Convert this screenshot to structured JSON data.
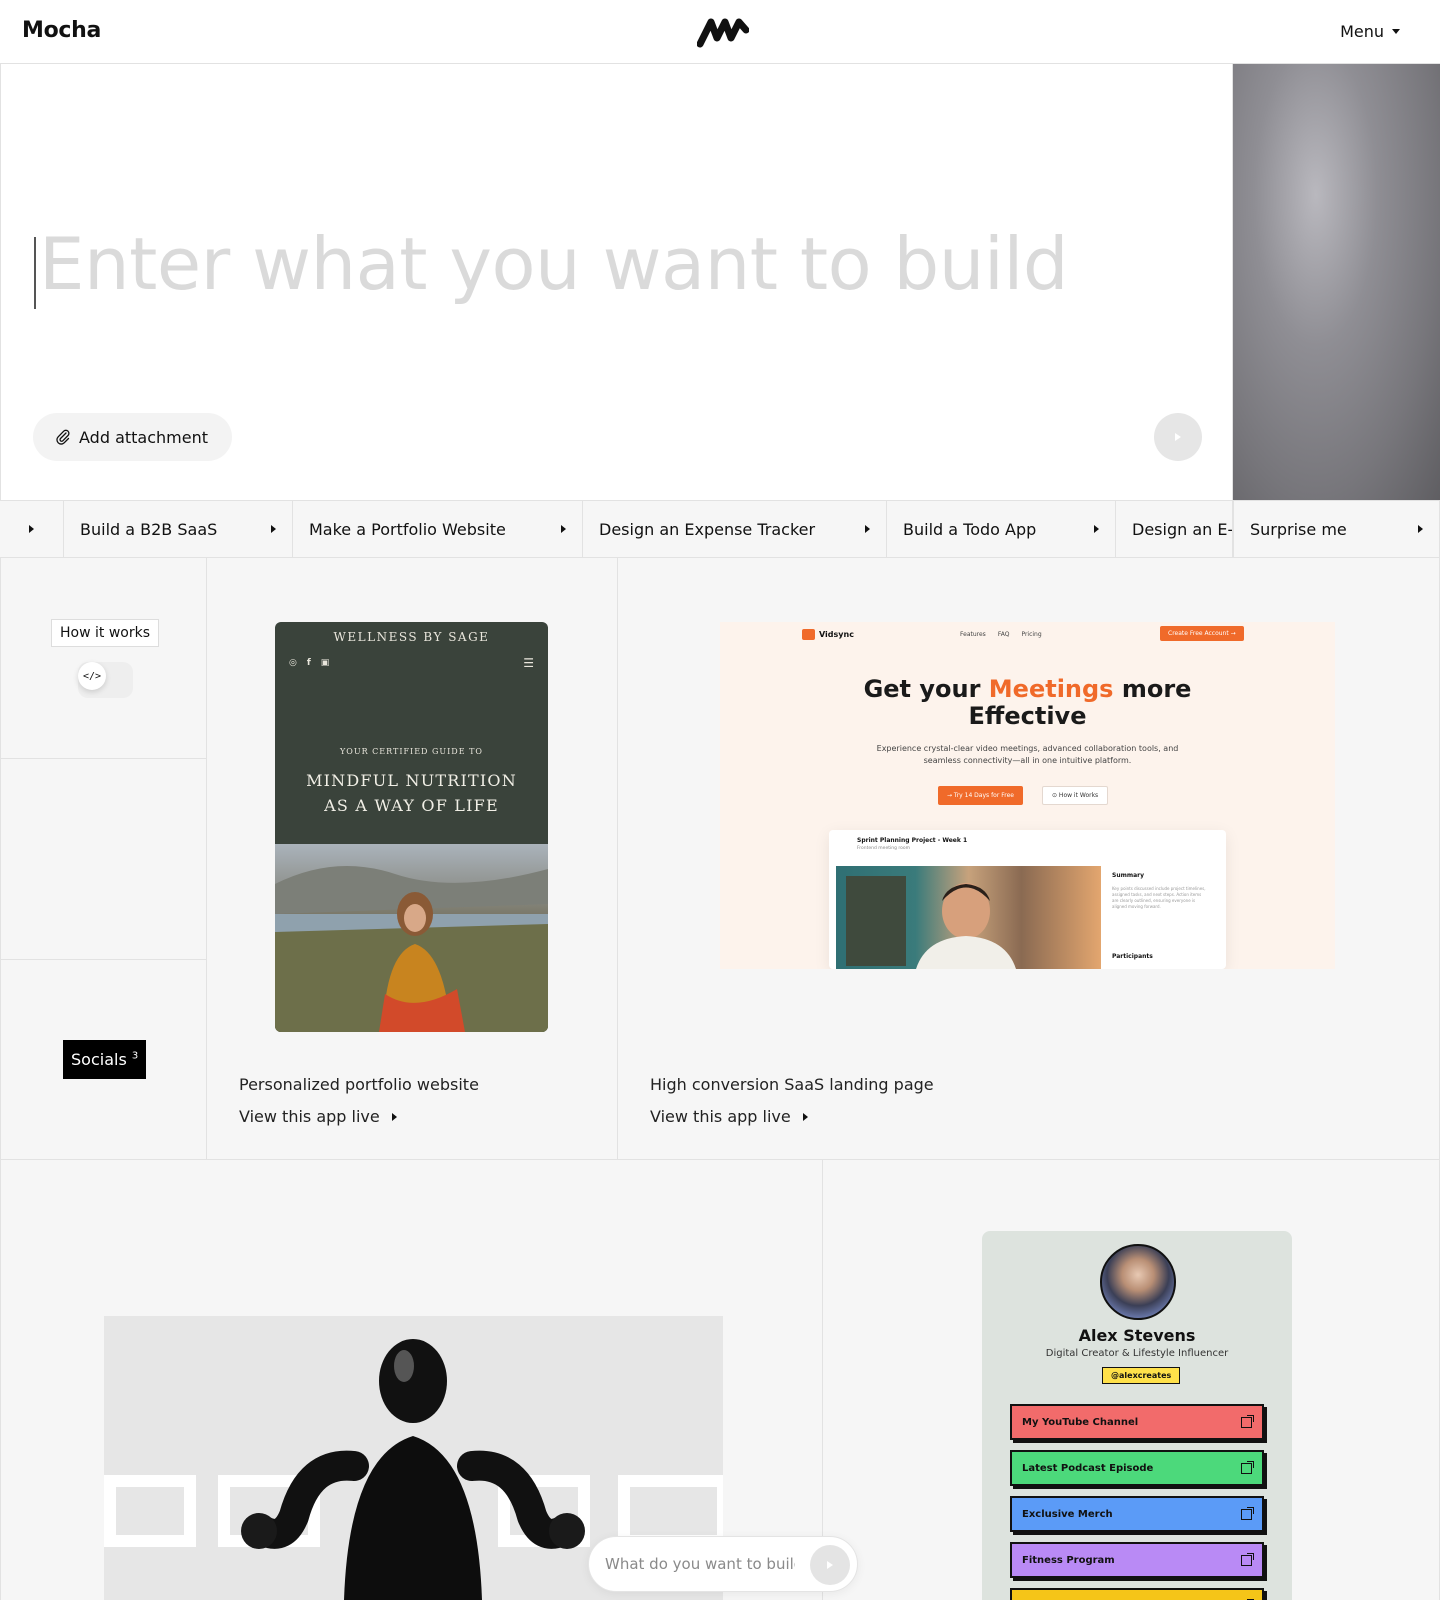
{
  "header": {
    "brand": "Mocha",
    "logo_icon": "mocha-wave-logo",
    "menu_label": "Menu"
  },
  "hero": {
    "prompt_placeholder": "Enter what you want to build",
    "attach_label": "Add attachment",
    "attach_icon": "paperclip-icon",
    "send_icon": "play-arrow-icon"
  },
  "suggestions": [
    "Build a B2B SaaS",
    "Make a Portfolio Website",
    "Design an Expense Tracker",
    "Build a Todo App",
    "Design an E-",
    "Surprise me"
  ],
  "sidebar": {
    "how_it_works": "How it works",
    "code_toggle": "</>",
    "socials_label": "Socials",
    "socials_count": "3"
  },
  "showcase": [
    {
      "caption": "Personalized portfolio website",
      "link": "View this app live",
      "preview": {
        "title": "WELLNESS BY SAGE",
        "subtitle": "YOUR CERTIFIED GUIDE TO",
        "headline_line1": "MINDFUL NUTRITION",
        "headline_line2": "AS A WAY OF LIFE"
      }
    },
    {
      "caption": "High conversion SaaS landing page",
      "link": "View this app live",
      "preview": {
        "logo": "Vidsync",
        "nav": [
          "Features",
          "FAQ",
          "Pricing"
        ],
        "cta": "Create Free Account →",
        "headline_a": "Get your ",
        "headline_accent": "Meetings",
        "headline_b": " more",
        "headline_line2": "Effective",
        "description": "Experience crystal-clear video meetings, advanced collaboration tools, and seamless connectivity—all in one intuitive platform.",
        "primary_btn": "→ Try 14 Days for Free",
        "secondary_btn": "⊙ How it Works",
        "app_title": "Sprint Planning Project - Week 1",
        "app_subtitle": "Frontend meeting room",
        "summary_label": "Summary",
        "summary_text": "Key points discussed include project timelines, assigned tasks, and next steps. Action items are clearly outlined, ensuring everyone is aligned moving forward.",
        "participants_label": "Participants"
      }
    }
  ],
  "bottom": {
    "mini_prompt_placeholder": "What do you want to build?",
    "profile": {
      "name": "Alex Stevens",
      "title": "Digital Creator & Lifestyle Influencer",
      "handle": "@alexcreates",
      "links": [
        {
          "label": "My YouTube Channel",
          "color": "#f26b6b"
        },
        {
          "label": "Latest Podcast Episode",
          "color": "#4cd97b"
        },
        {
          "label": "Exclusive Merch",
          "color": "#5b9bf7"
        },
        {
          "label": "Fitness Program",
          "color": "#b98af5"
        },
        {
          "label": "",
          "color": "#f5c518"
        }
      ]
    }
  },
  "colors": {
    "accent": "#f06a2a",
    "border": "#e2e2e2",
    "panel": "#f6f6f6"
  }
}
